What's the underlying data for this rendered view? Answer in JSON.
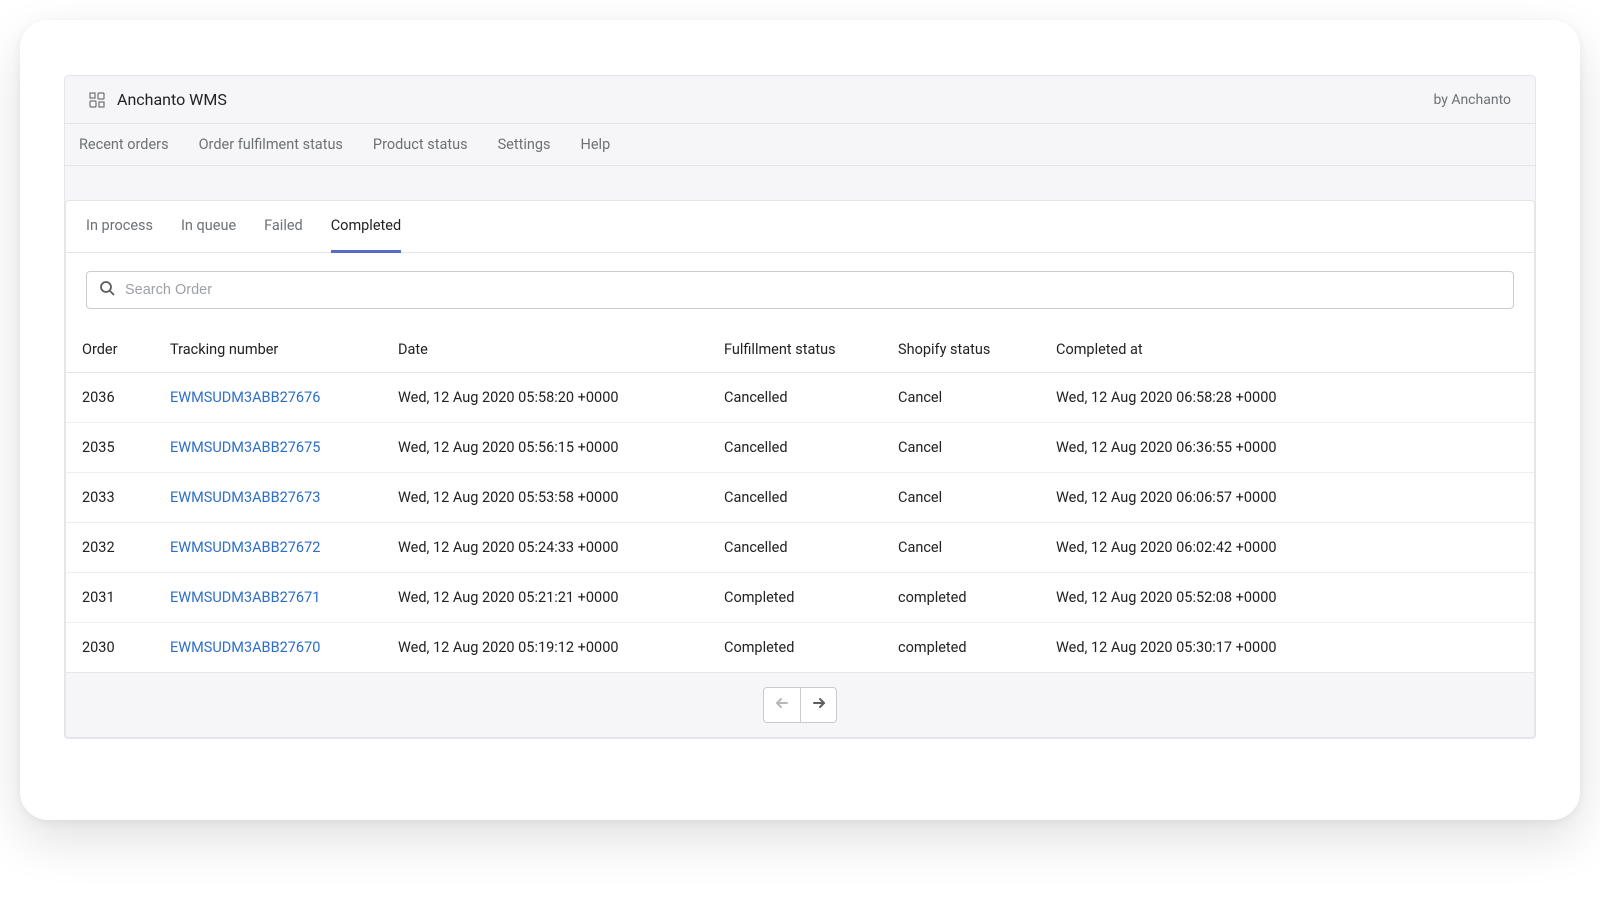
{
  "header": {
    "app_title": "Anchanto WMS",
    "by_text": "by Anchanto"
  },
  "nav": {
    "items": [
      {
        "label": "Recent orders"
      },
      {
        "label": "Order fulfilment status"
      },
      {
        "label": "Product status"
      },
      {
        "label": "Settings"
      },
      {
        "label": "Help"
      }
    ]
  },
  "tabs": {
    "items": [
      {
        "label": "In process",
        "active": false
      },
      {
        "label": "In queue",
        "active": false
      },
      {
        "label": "Failed",
        "active": false
      },
      {
        "label": "Completed",
        "active": true
      }
    ]
  },
  "search": {
    "placeholder": "Search Order",
    "value": ""
  },
  "table": {
    "columns": {
      "order": "Order",
      "tracking": "Tracking number",
      "date": "Date",
      "fulfillment": "Fulfillment status",
      "shopify": "Shopify status",
      "completed": "Completed at"
    },
    "rows": [
      {
        "order": "2036",
        "tracking": "EWMSUDM3ABB27676",
        "date": "Wed, 12 Aug 2020 05:58:20 +0000",
        "fulfillment": "Cancelled",
        "shopify": "Cancel",
        "completed": "Wed, 12 Aug 2020 06:58:28 +0000"
      },
      {
        "order": "2035",
        "tracking": "EWMSUDM3ABB27675",
        "date": "Wed, 12 Aug 2020 05:56:15 +0000",
        "fulfillment": "Cancelled",
        "shopify": "Cancel",
        "completed": "Wed, 12 Aug 2020 06:36:55 +0000"
      },
      {
        "order": "2033",
        "tracking": "EWMSUDM3ABB27673",
        "date": "Wed, 12 Aug 2020 05:53:58 +0000",
        "fulfillment": "Cancelled",
        "shopify": "Cancel",
        "completed": "Wed, 12 Aug 2020 06:06:57 +0000"
      },
      {
        "order": "2032",
        "tracking": "EWMSUDM3ABB27672",
        "date": "Wed, 12 Aug 2020 05:24:33 +0000",
        "fulfillment": "Cancelled",
        "shopify": "Cancel",
        "completed": "Wed, 12 Aug 2020 06:02:42 +0000"
      },
      {
        "order": "2031",
        "tracking": "EWMSUDM3ABB27671",
        "date": "Wed, 12 Aug 2020 05:21:21 +0000",
        "fulfillment": "Completed",
        "shopify": "completed",
        "completed": "Wed, 12 Aug 2020 05:52:08 +0000"
      },
      {
        "order": "2030",
        "tracking": "EWMSUDM3ABB27670",
        "date": "Wed, 12 Aug 2020 05:19:12 +0000",
        "fulfillment": "Completed",
        "shopify": "completed",
        "completed": "Wed, 12 Aug 2020 05:30:17 +0000"
      }
    ]
  }
}
